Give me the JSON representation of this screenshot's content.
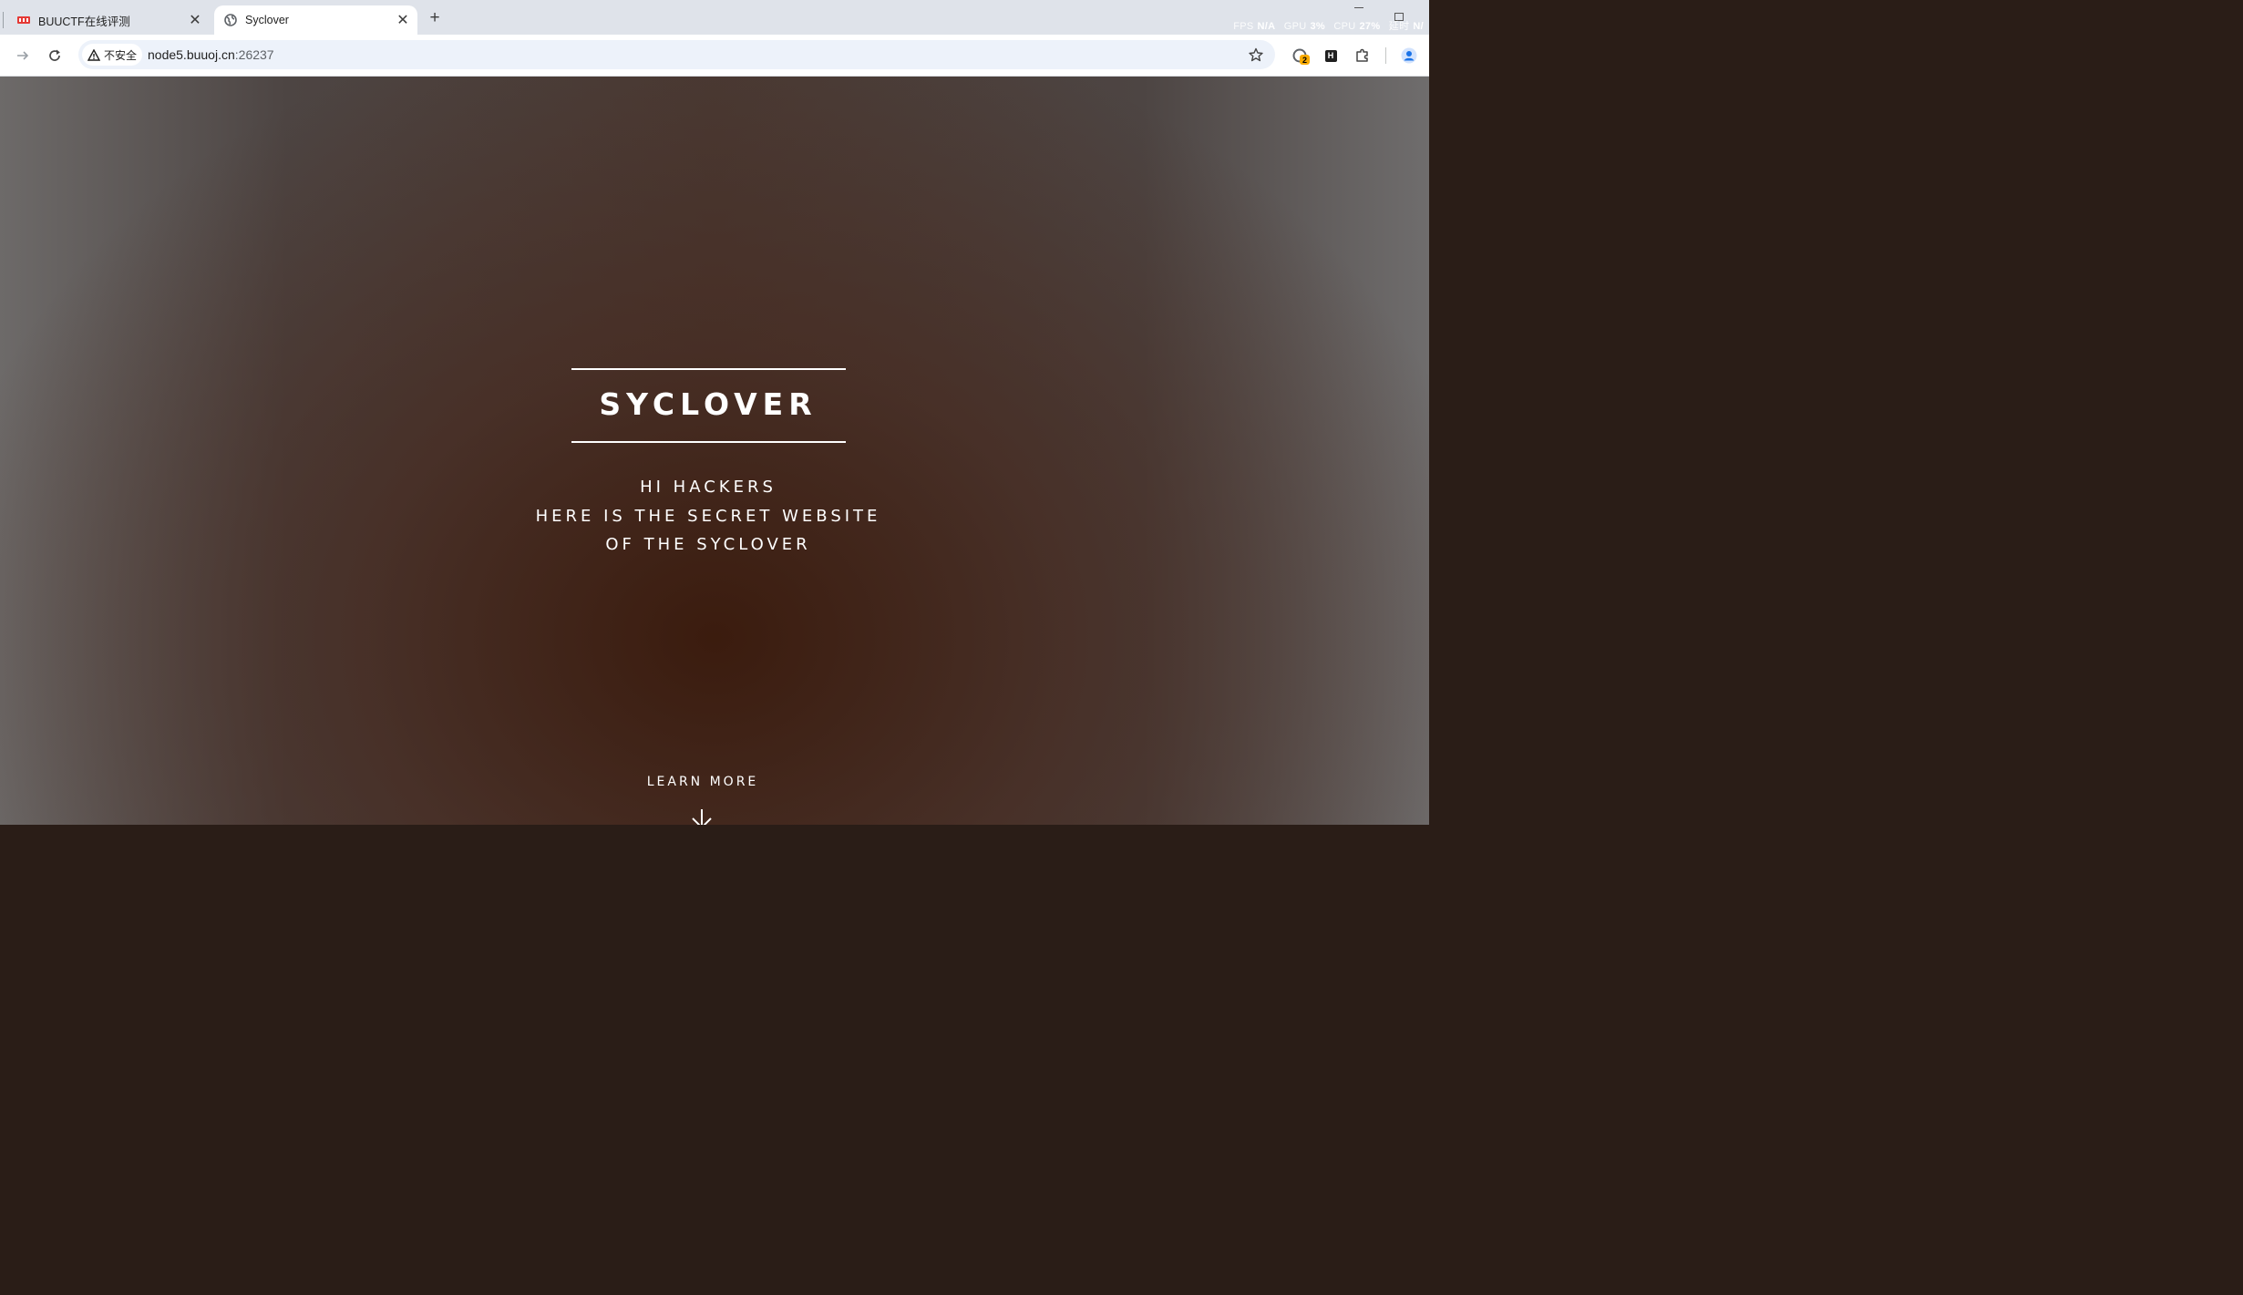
{
  "browser": {
    "tabs": [
      {
        "title": "BUUCTF在线评测",
        "favicon": "buuctf-logo-icon",
        "active": false
      },
      {
        "title": "Syclover",
        "favicon": "globe-icon",
        "active": true
      }
    ],
    "new_tab_symbol": "+",
    "perf_overlay": {
      "fps_label": "FPS",
      "fps_value": "N/A",
      "gpu_label": "GPU",
      "gpu_value": "3%",
      "cpu_label": "CPU",
      "cpu_value": "27%",
      "latency_label": "延时",
      "latency_value": "N/"
    },
    "security_label": "不安全",
    "url_host": "node5.buuoj.cn",
    "url_port": ":26237",
    "extension_badge": "2",
    "extension_h_label": "H"
  },
  "page": {
    "title": "SYCLOVER",
    "tagline": [
      "HI HACKERS",
      "HERE IS THE SECRET WEBSITE",
      "OF THE SYCLOVER"
    ],
    "learn_more": "LEARN MORE"
  },
  "colors": {
    "tabstrip": "#dfe3ea",
    "omnibox": "#edf2fa",
    "badge": "#f9ab00",
    "profile": "#1a73e8",
    "hero_text": "#ffffff"
  }
}
